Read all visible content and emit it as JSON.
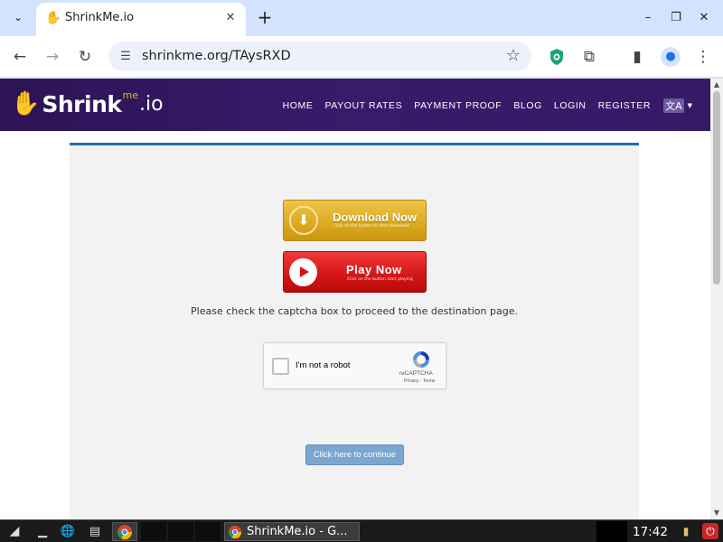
{
  "browser": {
    "tab_title": "ShrinkMe.io",
    "url": "shrinkme.org/TAysRXD",
    "new_tab_glyph": "+",
    "icons": {
      "tab_search": "chevron-down-icon",
      "close": "close-icon",
      "back": "back-arrow-icon",
      "forward": "forward-arrow-icon",
      "reload": "reload-icon",
      "bookmark": "star-icon",
      "extensions": "puzzle-icon",
      "sidepanel": "side-panel-icon",
      "menu": "kebab-menu-icon"
    }
  },
  "site": {
    "logo": {
      "shrink": "Shrink",
      "me": "me",
      "io": ".io"
    },
    "nav": [
      "HOME",
      "PAYOUT RATES",
      "PAYMENT PROOF",
      "BLOG",
      "LOGIN",
      "REGISTER"
    ],
    "lang_glyph": "文A"
  },
  "content": {
    "download_button": {
      "title": "Download Now",
      "subtitle": "Click on the button to start download"
    },
    "play_button": {
      "title": "Play Now",
      "subtitle": "Click on the button start playing"
    },
    "instructions": "Please check the captcha box to proceed to the destination page.",
    "captcha": {
      "label": "I'm not a robot",
      "brand": "reCAPTCHA",
      "links": "Privacy - Terms"
    },
    "continue_button": "Click here to continue"
  },
  "taskbar": {
    "task_label": "ShrinkMe.io - G...",
    "clock": "17:42"
  },
  "colors": {
    "header_bg": "#2c1456",
    "accent_blue": "#1f6fb2",
    "download_gold": "#dca91f",
    "play_red": "#d41414",
    "continue_btn": "#7aa6d1"
  }
}
